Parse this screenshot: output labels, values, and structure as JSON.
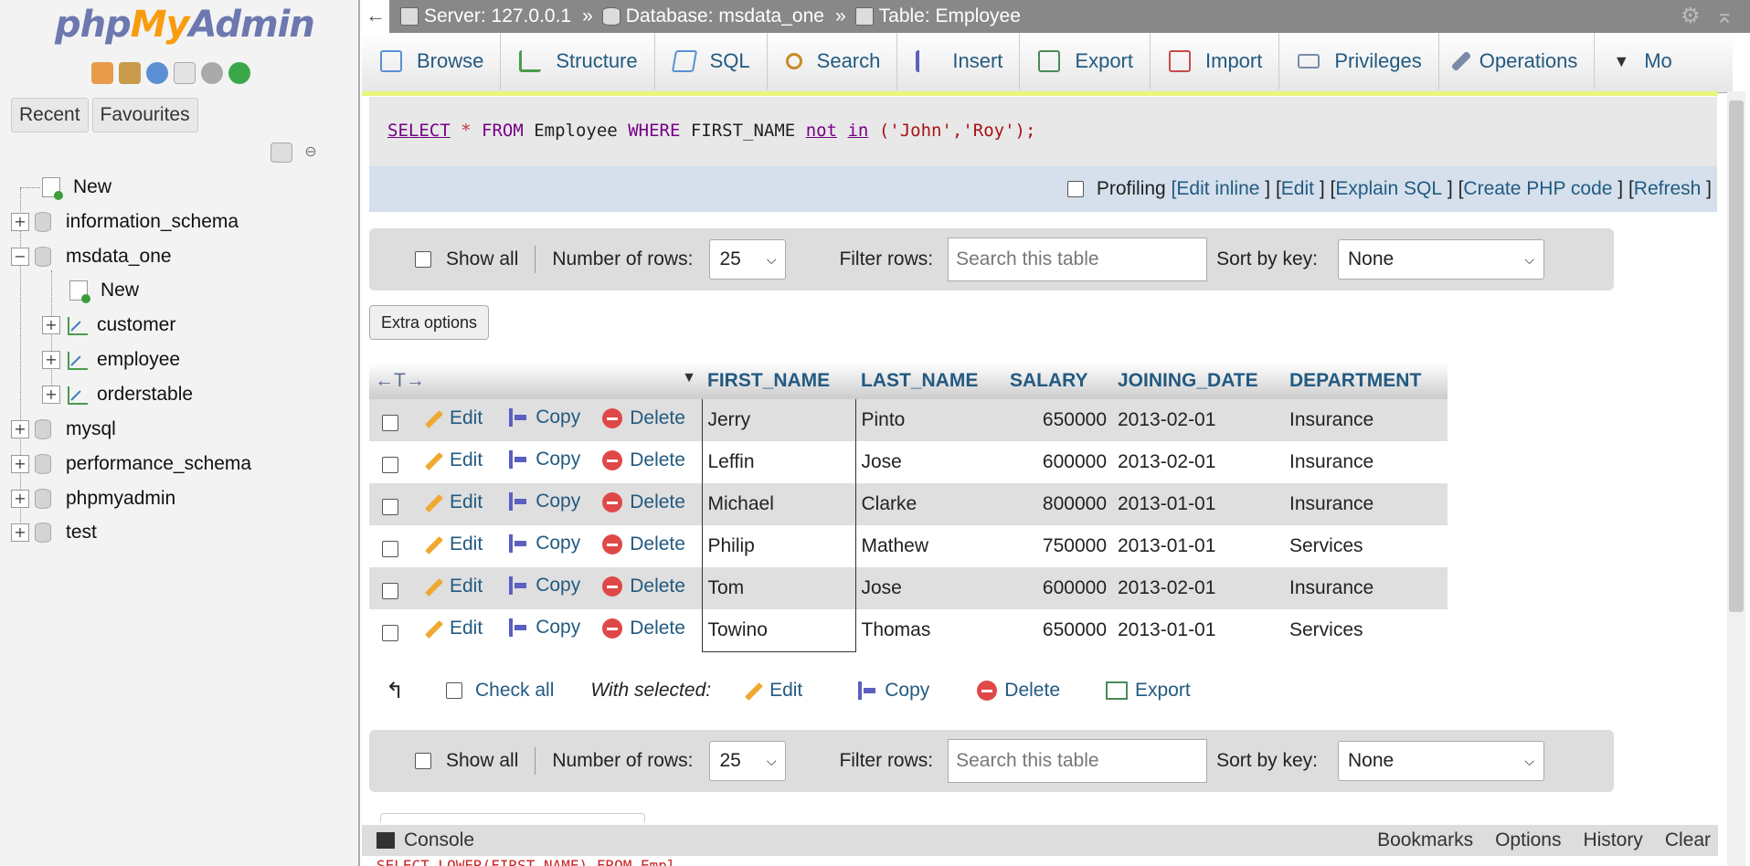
{
  "nav": {
    "logo": {
      "part1": "php",
      "part2": "My",
      "part3": "Admin"
    },
    "tabs": [
      "Recent",
      "Favourites"
    ],
    "tree": [
      {
        "label": "New",
        "type": "new"
      },
      {
        "label": "information_schema",
        "type": "db"
      },
      {
        "label": "msdata_one",
        "type": "db",
        "expanded": true
      },
      {
        "label": "New",
        "type": "new"
      },
      {
        "label": "customer",
        "type": "table"
      },
      {
        "label": "employee",
        "type": "table"
      },
      {
        "label": "orderstable",
        "type": "table"
      },
      {
        "label": "mysql",
        "type": "db"
      },
      {
        "label": "performance_schema",
        "type": "db"
      },
      {
        "label": "phpmyadmin",
        "type": "db"
      },
      {
        "label": "test",
        "type": "db"
      }
    ]
  },
  "breadcrumb": {
    "server": "Server: 127.0.0.1",
    "database": "Database: msdata_one",
    "table": "Table: Employee",
    "separator": "»"
  },
  "menu": [
    "Browse",
    "Structure",
    "SQL",
    "Search",
    "Insert",
    "Export",
    "Import",
    "Privileges",
    "Operations",
    "Mo"
  ],
  "sql": {
    "select": "SELECT",
    "star": "*",
    "from": "FROM",
    "table": "Employee",
    "where": "WHERE",
    "col": "FIRST_NAME",
    "not": "not",
    "in": "in",
    "values": "('John','Roy');"
  },
  "sql_actions": {
    "profiling": "Profiling",
    "edit_inline": "Edit inline",
    "edit": "Edit",
    "explain": "Explain SQL",
    "php": "Create PHP code",
    "refresh": "Refresh"
  },
  "controls": {
    "show_all": "Show all",
    "num_rows_label": "Number of rows:",
    "num_rows_value": "25",
    "filter_label": "Filter rows:",
    "filter_placeholder": "Search this table",
    "sort_label": "Sort by key:",
    "sort_value": "None",
    "extra_options": "Extra options"
  },
  "table": {
    "arrows": "←T→",
    "columns": [
      "FIRST_NAME",
      "LAST_NAME",
      "SALARY",
      "JOINING_DATE",
      "DEPARTMENT"
    ],
    "actions": {
      "edit": "Edit",
      "copy": "Copy",
      "delete": "Delete"
    },
    "rows": [
      [
        "Jerry",
        "Pinto",
        "650000",
        "2013-02-01",
        "Insurance"
      ],
      [
        "Leffin",
        "Jose",
        "600000",
        "2013-02-01",
        "Insurance"
      ],
      [
        "Michael",
        "Clarke",
        "800000",
        "2013-01-01",
        "Insurance"
      ],
      [
        "Philip",
        "Mathew",
        "750000",
        "2013-01-01",
        "Services"
      ],
      [
        "Tom",
        "Jose",
        "600000",
        "2013-02-01",
        "Insurance"
      ],
      [
        "Towino",
        "Thomas",
        "650000",
        "2013-01-01",
        "Services"
      ]
    ]
  },
  "with_selected": {
    "check_all": "Check all",
    "label": "With selected:",
    "edit": "Edit",
    "copy": "Copy",
    "delete": "Delete",
    "export": "Export"
  },
  "console": {
    "label": "Console",
    "bookmarks": "Bookmarks",
    "options": "Options",
    "history": "History",
    "clear": "Clear",
    "peek": "SELECT LOWER(FIRST_NAME) FROM Empl"
  },
  "colors": {
    "link": "#235a81",
    "topbar": "#888888",
    "sql_highlight": "#e9f57b"
  }
}
